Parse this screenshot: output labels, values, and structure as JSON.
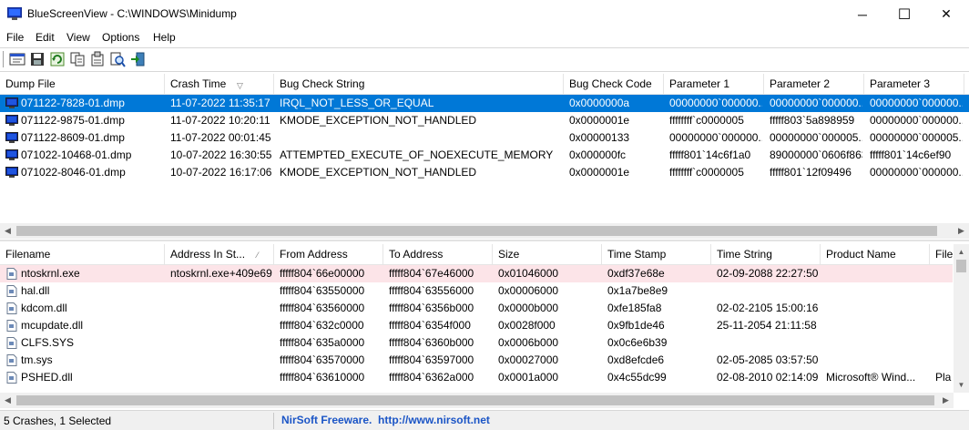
{
  "window": {
    "app_name": "BlueScreenView",
    "separator": " - ",
    "path": "C:\\WINDOWS\\Minidump",
    "minimize": "─",
    "maximize": "☐",
    "close": "✕"
  },
  "menu": [
    "File",
    "Edit",
    "View",
    "Options",
    "Help"
  ],
  "toolbar": [
    "properties-icon",
    "save-icon",
    "refresh-icon",
    "copy-icon",
    "report-icon",
    "find-icon",
    "exit-icon"
  ],
  "crashes": {
    "columns": [
      "Dump File",
      "Crash Time",
      "Bug Check String",
      "Bug Check Code",
      "Parameter 1",
      "Parameter 2",
      "Parameter 3"
    ],
    "sort_indicator": "▽",
    "rows": [
      [
        "071122-7828-01.dmp",
        "11-07-2022 11:35:17",
        "IRQL_NOT_LESS_OR_EQUAL",
        "0x0000000a",
        "00000000`000000...",
        "00000000`000000...",
        "00000000`000000..."
      ],
      [
        "071122-9875-01.dmp",
        "11-07-2022 10:20:11",
        "KMODE_EXCEPTION_NOT_HANDLED",
        "0x0000001e",
        "ffffffff`c0000005",
        "fffff803`5a898959",
        "00000000`000000..."
      ],
      [
        "071122-8609-01.dmp",
        "11-07-2022 00:01:45",
        "",
        "0x00000133",
        "00000000`000000...",
        "00000000`000005...",
        "00000000`000005..."
      ],
      [
        "071022-10468-01.dmp",
        "10-07-2022 16:30:55",
        "ATTEMPTED_EXECUTE_OF_NOEXECUTE_MEMORY",
        "0x000000fc",
        "fffff801`14c6f1a0",
        "89000000`0606f863",
        "fffff801`14c6ef90"
      ],
      [
        "071022-8046-01.dmp",
        "10-07-2022 16:17:06",
        "KMODE_EXCEPTION_NOT_HANDLED",
        "0x0000001e",
        "ffffffff`c0000005",
        "fffff801`12f09496",
        "00000000`000000..."
      ]
    ]
  },
  "drivers": {
    "columns": [
      "Filename",
      "Address In St...",
      "From Address",
      "To Address",
      "Size",
      "Time Stamp",
      "Time String",
      "Product Name",
      "File"
    ],
    "sort_indicator": "⁄",
    "rows": [
      [
        "ntoskrnl.exe",
        "ntoskrnl.exe+409e69",
        "fffff804`66e00000",
        "fffff804`67e46000",
        "0x01046000",
        "0xdf37e68e",
        "02-09-2088 22:27:50",
        "",
        ""
      ],
      [
        "hal.dll",
        "",
        "fffff804`63550000",
        "fffff804`63556000",
        "0x00006000",
        "0x1a7be8e9",
        "",
        "",
        ""
      ],
      [
        "kdcom.dll",
        "",
        "fffff804`63560000",
        "fffff804`6356b000",
        "0x0000b000",
        "0xfe185fa8",
        "02-02-2105 15:00:16",
        "",
        ""
      ],
      [
        "mcupdate.dll",
        "",
        "fffff804`632c0000",
        "fffff804`6354f000",
        "0x0028f000",
        "0x9fb1de46",
        "25-11-2054 21:11:58",
        "",
        ""
      ],
      [
        "CLFS.SYS",
        "",
        "fffff804`635a0000",
        "fffff804`6360b000",
        "0x0006b000",
        "0x0c6e6b39",
        "",
        "",
        ""
      ],
      [
        "tm.sys",
        "",
        "fffff804`63570000",
        "fffff804`63597000",
        "0x00027000",
        "0xd8efcde6",
        "02-05-2085 03:57:50",
        "",
        ""
      ],
      [
        "PSHED.dll",
        "",
        "fffff804`63610000",
        "fffff804`6362a000",
        "0x0001a000",
        "0x4c55dc99",
        "02-08-2010 02:14:09",
        "Microsoft® Wind...",
        "Pla"
      ]
    ]
  },
  "status": {
    "summary": "5 Crashes, 1 Selected",
    "link": "NirSoft Freeware.  http://www.nirsoft.net"
  },
  "colors": {
    "selection": "#0078d7",
    "highlight": "#fce4e8",
    "link": "#1b55c6"
  }
}
